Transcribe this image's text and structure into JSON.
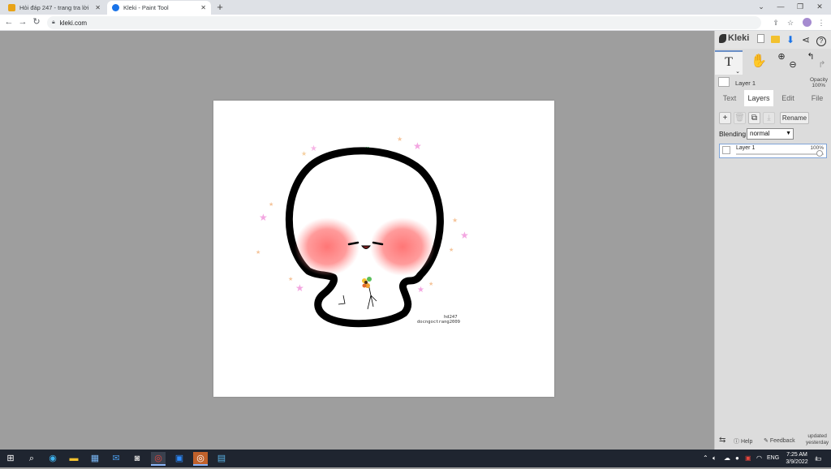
{
  "browser": {
    "tabs": [
      {
        "title": "Hỏi đáp 247 - trang tra lời",
        "favicon_color": "#e8a317",
        "active": false
      },
      {
        "title": "Kleki - Paint Tool",
        "favicon_color": "#1a73e8",
        "active": true
      }
    ],
    "url": "kleki.com",
    "new_tab_label": "+"
  },
  "kleki": {
    "logo_text": "Kleki",
    "tools": {
      "text_tool_label": "T"
    },
    "current_layer": "Layer 1",
    "opacity_label": "Opacity",
    "opacity_value": "100%",
    "tabs": [
      "Text",
      "Layers",
      "Edit",
      "File"
    ],
    "active_tab": "Layers",
    "layers_panel": {
      "rename_label": "Rename",
      "blending_label": "Blending",
      "blending_value": "normal",
      "layers": [
        {
          "name": "Layer 1",
          "opacity": "100%",
          "opacity_fraction": 1.0
        }
      ]
    },
    "footer": {
      "help_label": "Help",
      "feedback_label": "Feedback",
      "updated_label": "updated",
      "updated_value": "yesterday"
    }
  },
  "drawing": {
    "credit_line1": "hd247",
    "credit_line2": "docngoctrang2009"
  },
  "taskbar": {
    "language": "ENG",
    "time": "7:25 AM",
    "date": "3/9/2022",
    "notification_count": "1"
  },
  "colors": {
    "accent": "#6a8fc7",
    "workspace_bg": "#9e9e9e",
    "panel_bg": "#dcdcdc"
  }
}
